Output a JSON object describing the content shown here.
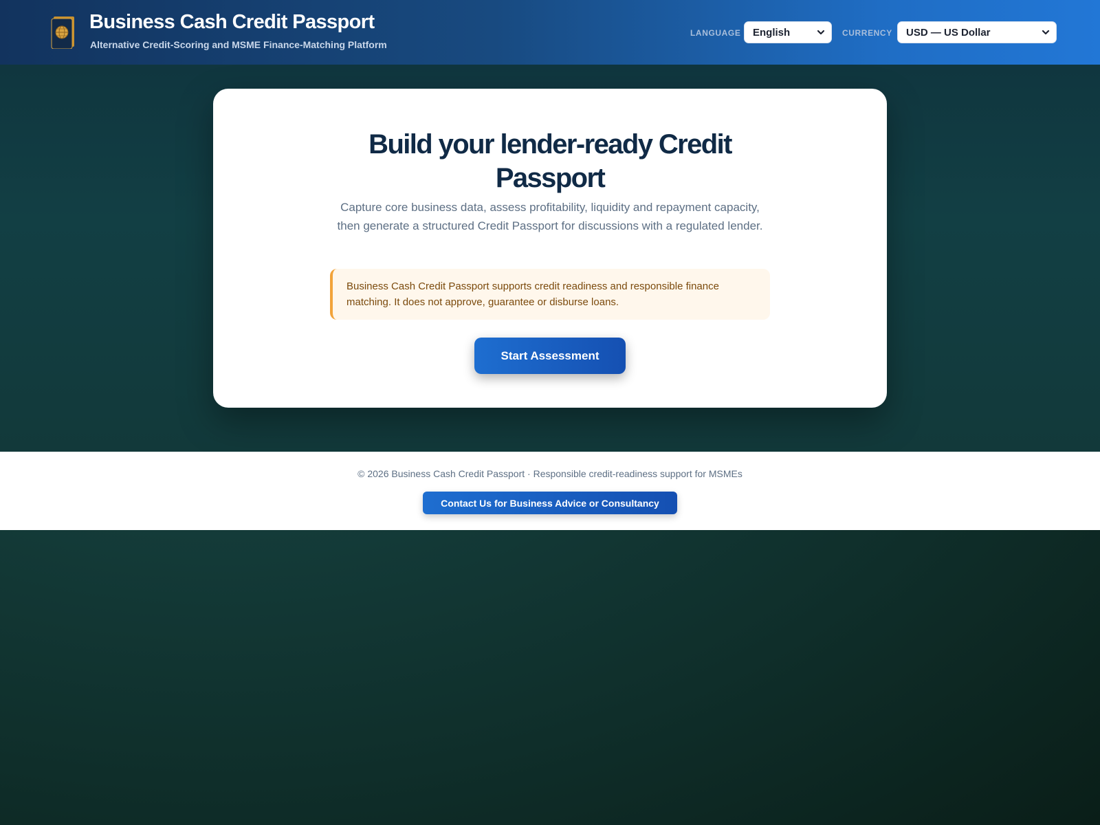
{
  "header": {
    "title": "Business Cash Credit Passport",
    "subtitle": "Alternative Credit-Scoring and MSME Finance-Matching Platform",
    "language_label": "LANGUAGE",
    "language_value": "English",
    "currency_label": "CURRENCY",
    "currency_value": "USD — US Dollar"
  },
  "hero": {
    "title": "Build your lender-ready Credit Passport",
    "description": "Capture core business data, assess profitability, liquidity and repayment capacity, then generate a structured Credit Passport for discussions with a regulated lender.",
    "notice": "Business Cash Credit Passport supports credit readiness and responsible finance matching. It does not approve, guarantee or disburse loans.",
    "start_button": "Start Assessment"
  },
  "footer": {
    "copyright": "© 2026 Business Cash Credit Passport · Responsible credit-readiness support for MSMEs",
    "contact_button": "Contact Us for Business Advice or Consultancy"
  },
  "colors": {
    "header_start": "#12335e",
    "header_end": "#2277d6",
    "primary_button": "#1e6ed0",
    "title_text": "#102a46",
    "notice_border": "#f2a33a",
    "notice_bg": "#fff7ec",
    "page_background": "#143c3a"
  },
  "icons": {
    "logo": "passport-icon",
    "language_select": "chevron-down-icon",
    "currency_select": "chevron-down-icon"
  }
}
